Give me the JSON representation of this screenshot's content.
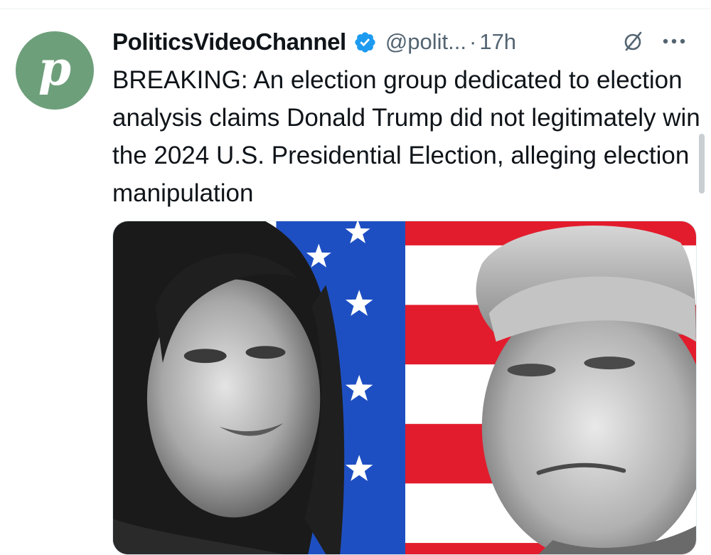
{
  "tweet": {
    "author": {
      "display_name": "PoliticsVideoChannel",
      "handle": "@polit...",
      "avatar_letter": "p",
      "avatar_color": "#6e9f7b",
      "verified": true,
      "verified_color": "#1d9bf0"
    },
    "separator": "·",
    "timestamp": "17h",
    "text": "BREAKING: An election group dedicated to election analysis claims Donald Trump did not legitimately win the 2024 U.S. Presidential Election, alleging election manipulation",
    "media": {
      "subject": "black-and-white portraits of a woman (left) and a man (right) over an American flag background",
      "flag_colors": {
        "blue": "#1e4fc2",
        "red": "#e21c2c",
        "white": "#ffffff"
      }
    }
  },
  "icons": {
    "verified": "verified-badge-icon",
    "grok": "grok-icon",
    "more": "more-options-icon"
  }
}
